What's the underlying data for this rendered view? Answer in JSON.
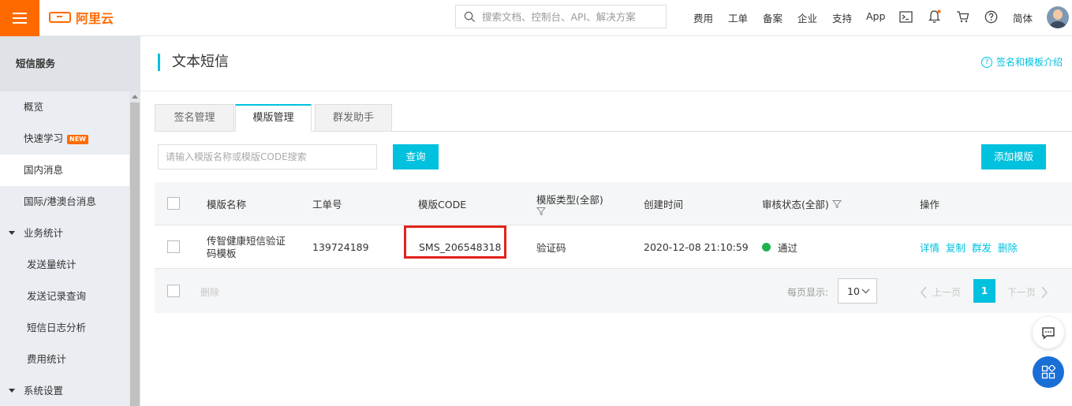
{
  "header": {
    "brand": "阿里云",
    "search_placeholder": "搜索文档、控制台、API、解决方案",
    "nav": [
      "费用",
      "工单",
      "备案",
      "企业",
      "支持",
      "App"
    ],
    "lang": "简体",
    "brand_color": "#ff6a00",
    "accent_color": "#00c1de"
  },
  "sidebar": {
    "title": "短信服务",
    "items": [
      {
        "label": "概览"
      },
      {
        "label": "快速学习",
        "badge": "NEW"
      },
      {
        "label": "国内消息"
      },
      {
        "label": "国际/港澳台消息"
      },
      {
        "label": "业务统计"
      },
      {
        "label": "发送量统计"
      },
      {
        "label": "发送记录查询"
      },
      {
        "label": "短信日志分析"
      },
      {
        "label": "费用统计"
      },
      {
        "label": "系统设置"
      }
    ]
  },
  "main": {
    "title": "文本短信",
    "help_link": "签名和模板介绍",
    "tabs": [
      "签名管理",
      "模版管理",
      "群发助手"
    ],
    "search_placeholder": "请输入模版名称或模版CODE搜索",
    "query_button": "查询",
    "add_button": "添加模版",
    "table": {
      "headers": [
        "模版名称",
        "工单号",
        "模版CODE",
        "模版类型(全部)",
        "创建时间",
        "审核状态(全部)",
        "操作"
      ],
      "rows": [
        {
          "name": "传智健康短信验证码模板",
          "name_line1": "传智健康短信验证",
          "name_line2": "码模板",
          "ticket": "139724189",
          "code": "SMS_206548318",
          "type": "验证码",
          "created": "2020-12-08 21:10:59",
          "status": "通过",
          "actions": [
            "详情",
            "复制",
            "群发",
            "删除"
          ]
        }
      ]
    },
    "footer": {
      "delete": "删除",
      "page_size_label": "每页显示:",
      "page_size": "10",
      "prev": "上一页",
      "current_page": "1",
      "next": "下一页"
    }
  }
}
